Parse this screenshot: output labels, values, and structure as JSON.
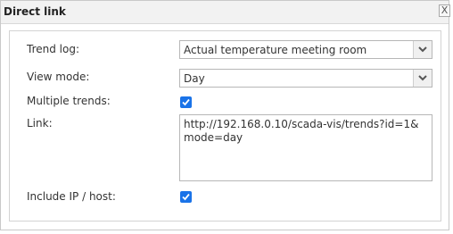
{
  "dialog": {
    "title": "Direct link",
    "close_label": "X"
  },
  "form": {
    "trend_log": {
      "label": "Trend log:",
      "value": "Actual temperature meeting room"
    },
    "view_mode": {
      "label": "View mode:",
      "value": "Day"
    },
    "multiple_trends": {
      "label": "Multiple trends:",
      "checked": true
    },
    "link": {
      "label": "Link:",
      "value": "http://192.168.0.10/scada-vis/trends?id=1&mode=day"
    },
    "include_ip": {
      "label": "Include IP / host:",
      "checked": true
    }
  },
  "colors": {
    "checkbox_accent": "#1a73e8",
    "titlebar_bg": "#f2f2f2"
  }
}
